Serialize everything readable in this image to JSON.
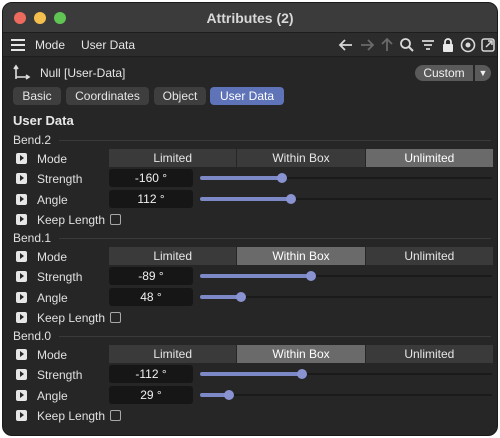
{
  "window": {
    "title": "Attributes (2)"
  },
  "menubar": {
    "items": [
      "Mode",
      "User Data"
    ],
    "tools": [
      "back-arrow-icon",
      "forward-arrow-icon",
      "up-arrow-icon",
      "search-icon",
      "filter-icon",
      "lock-icon",
      "target-icon",
      "new-window-icon"
    ]
  },
  "object": {
    "name": "Null [User-Data]",
    "layout_label": "Custom"
  },
  "tabs": [
    "Basic",
    "Coordinates",
    "Object",
    "User Data"
  ],
  "active_tab": "User Data",
  "section_title": "User Data",
  "mode_options": [
    "Limited",
    "Within Box",
    "Unlimited"
  ],
  "groups": [
    {
      "name": "Bend.2",
      "mode_label": "Mode",
      "mode_selected": "Unlimited",
      "strength_label": "Strength",
      "strength_value": "-160 °",
      "strength_fraction": 0.28,
      "angle_label": "Angle",
      "angle_value": "112 °",
      "angle_fraction": 0.31,
      "keep_label": "Keep Length",
      "keep_checked": false
    },
    {
      "name": "Bend.1",
      "mode_label": "Mode",
      "mode_selected": "Within Box",
      "strength_label": "Strength",
      "strength_value": "-89 °",
      "strength_fraction": 0.38,
      "angle_label": "Angle",
      "angle_value": "48 °",
      "angle_fraction": 0.14,
      "keep_label": "Keep Length",
      "keep_checked": false
    },
    {
      "name": "Bend.0",
      "mode_label": "Mode",
      "mode_selected": "Within Box",
      "strength_label": "Strength",
      "strength_value": "-112 °",
      "strength_fraction": 0.35,
      "angle_label": "Angle",
      "angle_value": "29 °",
      "angle_fraction": 0.1,
      "keep_label": "Keep Length",
      "keep_checked": false
    }
  ],
  "colors": {
    "accent": "#5e73b8",
    "slider": "#7d89c6",
    "panel": "#262626"
  }
}
